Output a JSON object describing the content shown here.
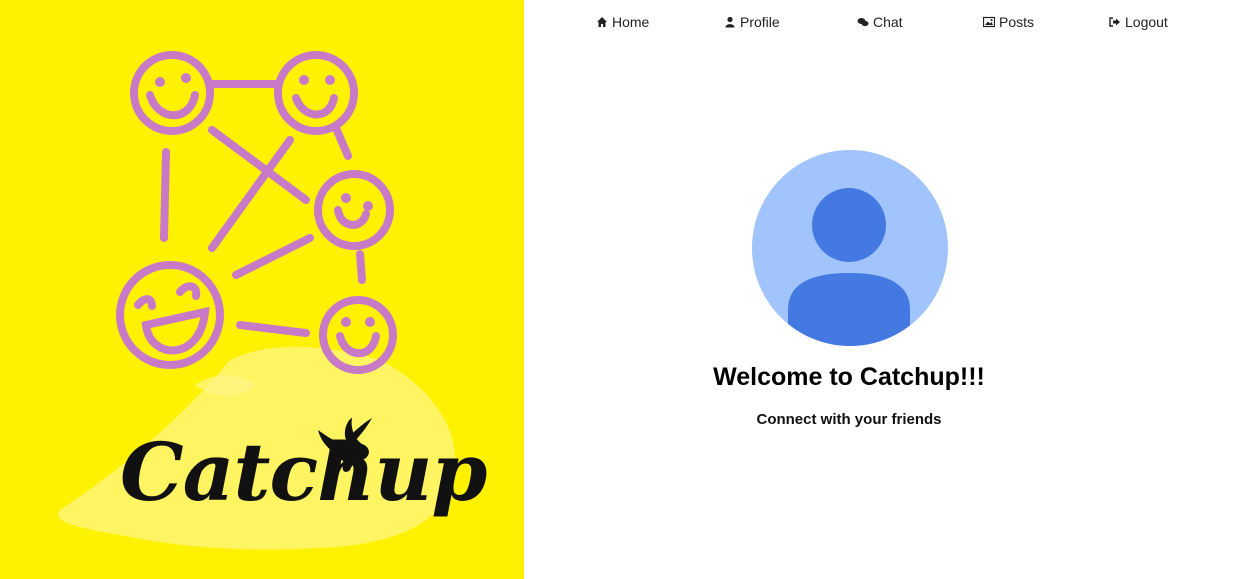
{
  "colors": {
    "brand_yellow": "#fff200",
    "face_purple": "#c97ac7",
    "avatar_light": "#a1c4fd",
    "avatar_dark": "#4479e1",
    "text_dark": "#111111"
  },
  "brand": {
    "logo_text": "Catchup",
    "logo_icon": "bird-icon",
    "illustration": "connected-smiley-faces"
  },
  "nav": {
    "items": [
      {
        "label": "Home",
        "icon": "home-icon"
      },
      {
        "label": "Profile",
        "icon": "user-icon"
      },
      {
        "label": "Chat",
        "icon": "chat-icon"
      },
      {
        "label": "Posts",
        "icon": "image-icon"
      },
      {
        "label": "Logout",
        "icon": "logout-icon"
      }
    ]
  },
  "main": {
    "avatar_icon": "default-avatar-icon",
    "title": "Welcome to Catchup!!!",
    "subtitle": "Connect with your friends"
  }
}
